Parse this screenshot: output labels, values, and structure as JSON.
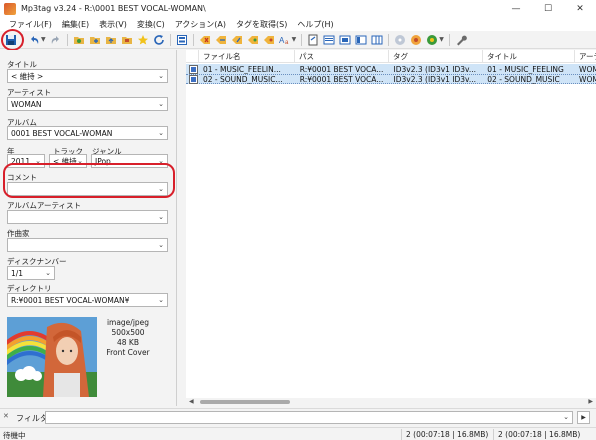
{
  "window": {
    "title": "Mp3tag v3.24  -  R:\\0001 BEST VOCAL-WOMAN\\",
    "minimize": "—",
    "maximize": "☐",
    "close": "✕"
  },
  "menu": [
    "ファイル(F)",
    "編集(E)",
    "表示(V)",
    "変換(C)",
    "アクション(A)",
    "タグを取得(S)",
    "ヘルプ(H)"
  ],
  "tag_panel": {
    "title": {
      "label": "タイトル",
      "value": "< 維持 >"
    },
    "artist": {
      "label": "アーティスト",
      "value": "WOMAN"
    },
    "album": {
      "label": "アルバム",
      "value": "0001 BEST VOCAL-WOMAN"
    },
    "year": {
      "label": "年",
      "value": "2011"
    },
    "track": {
      "label": "トラック",
      "value": "< 維持"
    },
    "genre": {
      "label": "ジャンル",
      "value": "JPop"
    },
    "comment": {
      "label": "コメント",
      "value": ""
    },
    "album_artist": {
      "label": "アルバムアーティスト",
      "value": ""
    },
    "composer": {
      "label": "作曲家",
      "value": ""
    },
    "discnumber": {
      "label": "ディスクナンバー",
      "value": "1/1"
    },
    "directory": {
      "label": "ディレクトリ",
      "value": "R:¥0001 BEST VOCAL-WOMAN¥"
    },
    "cover": {
      "format": "image/jpeg",
      "dimensions": "500x500",
      "size": "48 KB",
      "type": "Front Cover"
    }
  },
  "file_list": {
    "columns": [
      "ファイル名",
      "パス",
      "タグ",
      "タイトル",
      "アーテ"
    ],
    "rows": [
      {
        "filename": "01 - MUSIC_FEELIN...",
        "path": "R:¥0001 BEST VOCA...",
        "tag": "ID3v2.3 (ID3v1 ID3v...",
        "title": "01 - MUSIC_FEELING",
        "artist": "WOM"
      },
      {
        "filename": "02 - SOUND_MUSIC...",
        "path": "R:¥0001 BEST VOCA...",
        "tag": "ID3v2.3 (ID3v1 ID3v...",
        "title": "02 - SOUND_MUSIC",
        "artist": "WOM"
      }
    ]
  },
  "filter": {
    "label": "フィルタ:",
    "value": ""
  },
  "status": {
    "left": "待機中",
    "selected": "2 (00:07:18 | 16.8MB)",
    "total": "2 (00:07:18 | 16.8MB)"
  },
  "colors": {
    "highlight": "#d81f2a",
    "selection": "#cfe4f7",
    "window_bg": "#f3f3f3"
  }
}
